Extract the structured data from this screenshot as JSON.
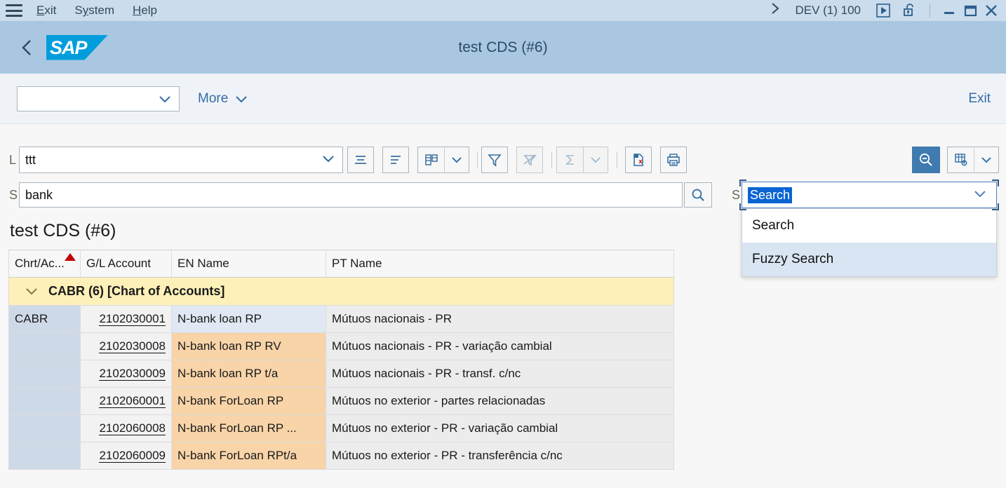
{
  "menubar": {
    "burger_icon": "hamburger-menu-icon",
    "items": [
      {
        "label": "Exit",
        "underline": "E"
      },
      {
        "label": "System",
        "underline": "y"
      },
      {
        "label": "Help",
        "underline": "H"
      }
    ],
    "chevron_right": "›",
    "system_id": "DEV (1) 100",
    "icons": [
      "play-button-icon",
      "unlock-icon"
    ],
    "window_controls": [
      "minimize-icon",
      "maximize-icon",
      "close-icon"
    ]
  },
  "appheader": {
    "back_icon": "back-chevron-icon",
    "logo_text": "SAP",
    "title": "test CDS (#6)"
  },
  "toolbar2": {
    "variant_value": "",
    "more_label": "More",
    "exit_label": "Exit"
  },
  "toolbar3": {
    "layout_label": "L",
    "layout_value": "ttt",
    "buttons": [
      {
        "name": "sort-ascending-button",
        "icon": "sort-ascending-icon",
        "disabled": false
      },
      {
        "name": "sort-descending-button",
        "icon": "sort-descending-icon",
        "disabled": false
      },
      {
        "name": "change-layout-button",
        "icon": "table-layout-icon",
        "disabled": false
      },
      {
        "name": "change-layout-menu-button",
        "icon": "chevron-down-icon",
        "disabled": false
      },
      {
        "name": "filter-button",
        "icon": "filter-icon",
        "disabled": false
      },
      {
        "name": "delete-filter-button",
        "icon": "filter-off-icon",
        "disabled": true
      },
      {
        "name": "total-button",
        "icon": "sigma-icon",
        "disabled": true
      },
      {
        "name": "total-menu-button",
        "icon": "chevron-down-icon",
        "disabled": true
      },
      {
        "name": "export-excel-button",
        "icon": "excel-export-icon",
        "disabled": false
      },
      {
        "name": "print-button",
        "icon": "printer-icon",
        "disabled": false
      },
      {
        "name": "hide-search-button",
        "icon": "search-minus-icon",
        "disabled": false
      },
      {
        "name": "table-settings-button",
        "icon": "table-settings-icon",
        "disabled": false
      },
      {
        "name": "table-settings-menu-button",
        "icon": "chevron-down-icon",
        "disabled": false
      }
    ]
  },
  "searchrow": {
    "search_label": "S",
    "search_value": "bank",
    "search_icon": "magnifier-icon",
    "mode_label": "S",
    "mode_selected": "Search",
    "mode_options": [
      {
        "label": "Search",
        "hovered": false
      },
      {
        "label": "Fuzzy Search",
        "hovered": true
      }
    ]
  },
  "content": {
    "title": "test CDS (#6)",
    "columns": [
      {
        "label": "Chrt/Ac...",
        "sorted": "asc"
      },
      {
        "label": "G/L Account",
        "sorted": ""
      },
      {
        "label": "EN Name",
        "sorted": ""
      },
      {
        "label": "PT Name",
        "sorted": ""
      }
    ],
    "group_row": {
      "expand_icon": "chevron-down-icon",
      "label": "CABR (6) [Chart of Accounts]"
    },
    "rows": [
      {
        "chrt": "CABR",
        "account": "2102030001",
        "en": "N-bank loan RP",
        "pt": "Mútuos nacionais - PR",
        "en_state": "selected"
      },
      {
        "chrt": "",
        "account": "2102030008",
        "en": "N-bank loan RP RV",
        "pt": "Mútuos nacionais - PR - variação cambial",
        "en_state": "match"
      },
      {
        "chrt": "",
        "account": "2102030009",
        "en": "N-bank loan RP t/a",
        "pt": "Mútuos nacionais - PR - transf. c/nc",
        "en_state": "match"
      },
      {
        "chrt": "",
        "account": "2102060001",
        "en": "N-bank ForLoan RP",
        "pt": "Mútuos no exterior - partes relacionadas",
        "en_state": "match"
      },
      {
        "chrt": "",
        "account": "2102060008",
        "en": "N-bank ForLoan RP ...",
        "pt": "Mútuos no exterior - PR - variação cambial",
        "en_state": "match"
      },
      {
        "chrt": "",
        "account": "2102060009",
        "en": "N-bank ForLoan RPt/a",
        "pt": "Mútuos no exterior - PR - transferência c/nc",
        "en_state": "match"
      }
    ]
  },
  "colors": {
    "menubar_bg": "#cbdcec",
    "appheader_bg": "#a9c7e0",
    "sap_blue": "#009ddc",
    "link_blue": "#356BA4",
    "selection_blue": "#0a64d2",
    "group_row_bg": "#fdf0b8",
    "match_bg": "#f8d4a8",
    "key_col_bg": "#ced9e8",
    "sort_triangle": "#c00000"
  }
}
